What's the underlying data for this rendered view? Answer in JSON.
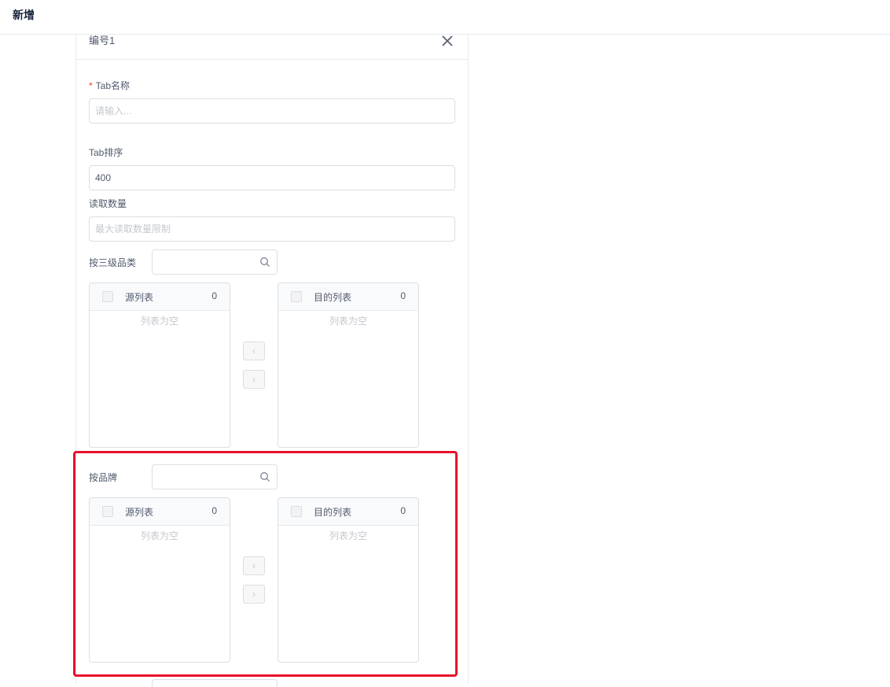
{
  "header": {
    "title": "新增"
  },
  "panel": {
    "title": "编号1"
  },
  "form": {
    "tab_name": {
      "required_mark": "*",
      "label": "Tab名称",
      "value": "",
      "placeholder": "请输入..."
    },
    "tab_order": {
      "label": "Tab排序",
      "value": "400",
      "placeholder": ""
    },
    "read_count": {
      "label": "读取数量",
      "value": "",
      "placeholder": "最大读取数量限制"
    },
    "by_category": {
      "label": "按三级品类",
      "search_value": "",
      "source": {
        "title": "源列表",
        "count": "0",
        "empty_text": "列表为空"
      },
      "target": {
        "title": "目的列表",
        "count": "0",
        "empty_text": "列表为空"
      },
      "left_arrow": "‹",
      "right_arrow": "›"
    },
    "by_brand": {
      "label": "按品牌",
      "search_value": "",
      "source": {
        "title": "源列表",
        "count": "0",
        "empty_text": "列表为空"
      },
      "target": {
        "title": "目的列表",
        "count": "0",
        "empty_text": "列表为空"
      },
      "left_arrow": "‹",
      "right_arrow": "›"
    }
  },
  "colors": {
    "highlight": "#e8112d",
    "required": "#ed4014",
    "border": "#dcdee2"
  },
  "icons": [
    "close-icon",
    "search-icon",
    "chevron-left-icon",
    "chevron-right-icon"
  ]
}
